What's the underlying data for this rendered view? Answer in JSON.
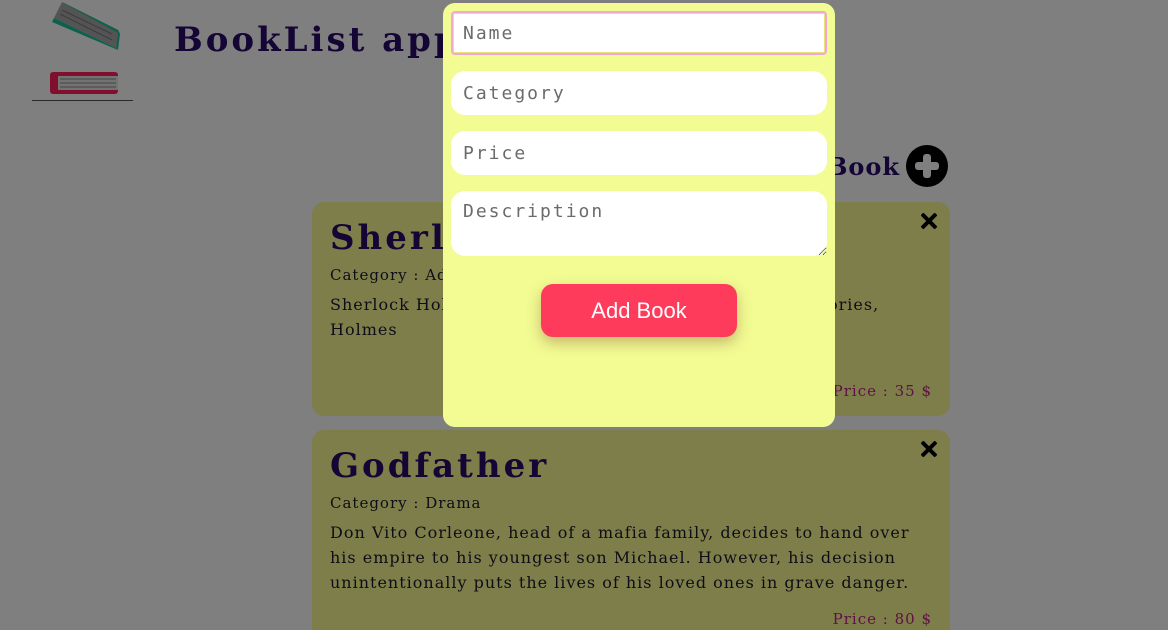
{
  "header": {
    "title": "BookList app",
    "logo_icon": "books-logo-icon"
  },
  "add_link": {
    "label": "Book",
    "icon": "plus-circle-icon"
  },
  "books": [
    {
      "title": "Sherlo",
      "category": "Category : Adve",
      "description": "Sherlock Holm                                                     author Sir Arthur Conan D                                               ve\" in the stories, Holmes",
      "price": "Price : 35 $"
    },
    {
      "title": "Godfather",
      "category": "Category : Drama",
      "description": "Don Vito Corleone, head of a mafia family, decides to hand over his empire to his youngest son Michael. However, his decision unintentionally puts the lives of his loved ones in grave danger.",
      "price": "Price : 80 $"
    }
  ],
  "modal": {
    "name_placeholder": "Name",
    "category_placeholder": "Category",
    "price_placeholder": "Price",
    "description_placeholder": "Description",
    "submit_label": "Add Book"
  },
  "colors": {
    "accent": "#ff3b5c",
    "title": "#2a0a6b",
    "card_bg": "#fdfd96",
    "modal_bg": "#f2fc93",
    "price": "#c0208a"
  }
}
